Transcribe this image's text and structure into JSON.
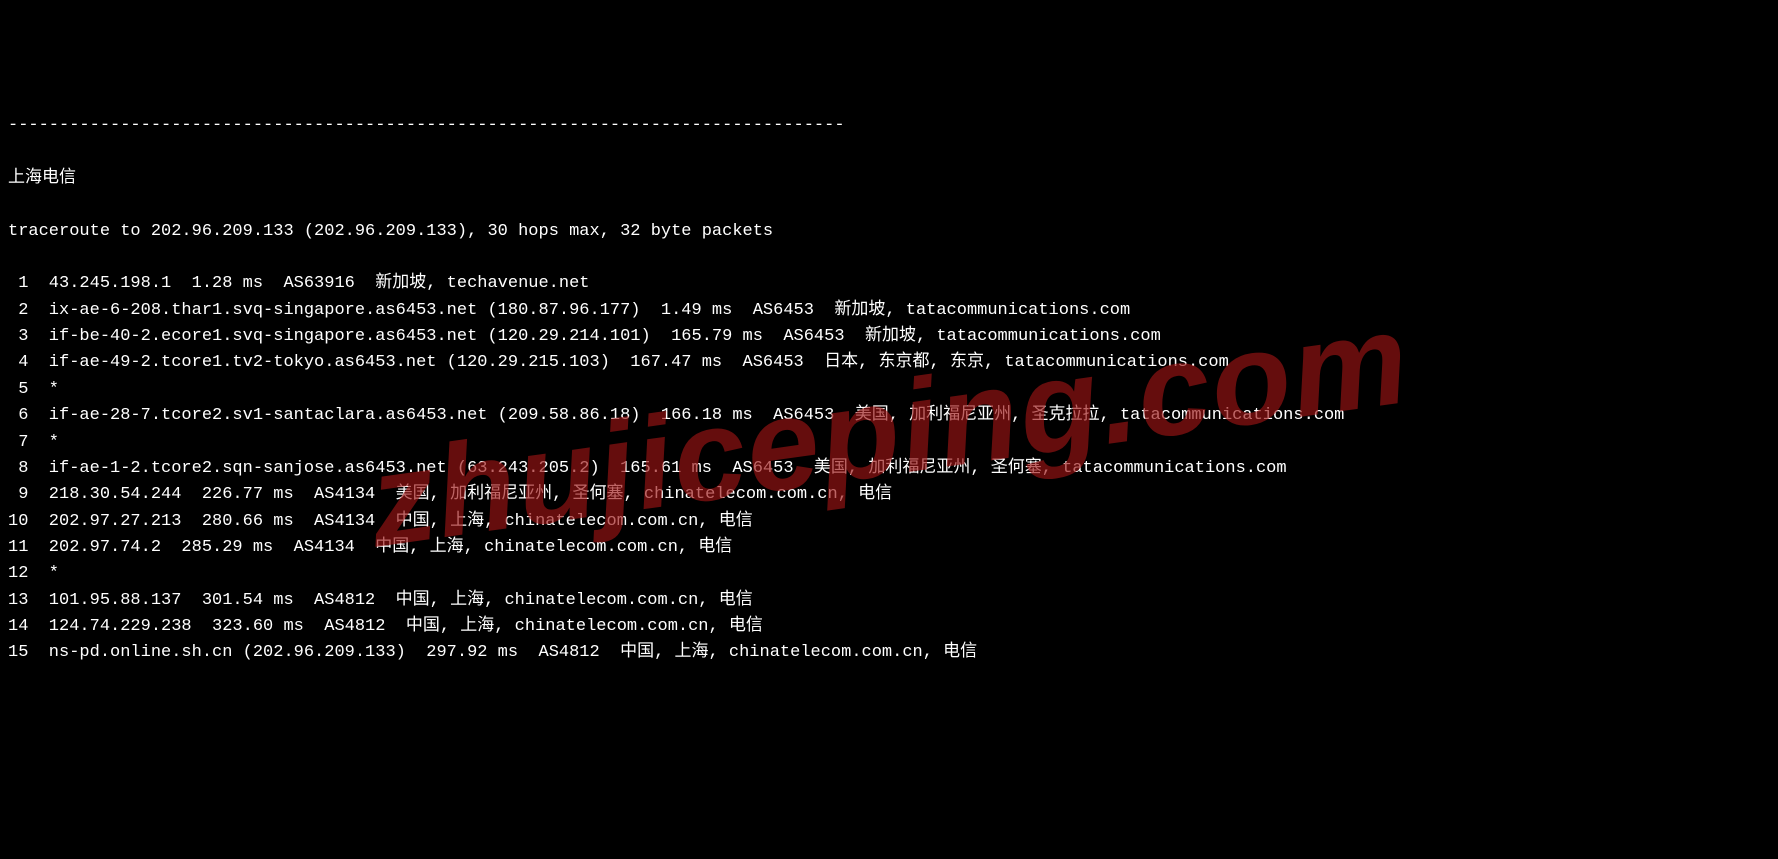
{
  "separator": "----------------------------------------------------------------------------------",
  "title": "上海电信",
  "header": "traceroute to 202.96.209.133 (202.96.209.133), 30 hops max, 32 byte packets",
  "hops": [
    {
      "n": " 1",
      "text": "43.245.198.1  1.28 ms  AS63916  新加坡, techavenue.net"
    },
    {
      "n": " 2",
      "text": "ix-ae-6-208.thar1.svq-singapore.as6453.net (180.87.96.177)  1.49 ms  AS6453  新加坡, tatacommunications.com"
    },
    {
      "n": " 3",
      "text": "if-be-40-2.ecore1.svq-singapore.as6453.net (120.29.214.101)  165.79 ms  AS6453  新加坡, tatacommunications.com"
    },
    {
      "n": " 4",
      "text": "if-ae-49-2.tcore1.tv2-tokyo.as6453.net (120.29.215.103)  167.47 ms  AS6453  日本, 东京都, 东京, tatacommunications.com"
    },
    {
      "n": " 5",
      "text": "*"
    },
    {
      "n": " 6",
      "text": "if-ae-28-7.tcore2.sv1-santaclara.as6453.net (209.58.86.18)  166.18 ms  AS6453  美国, 加利福尼亚州, 圣克拉拉, tatacommunications.com"
    },
    {
      "n": " 7",
      "text": "*"
    },
    {
      "n": " 8",
      "text": "if-ae-1-2.tcore2.sqn-sanjose.as6453.net (63.243.205.2)  165.61 ms  AS6453  美国, 加利福尼亚州, 圣何塞, tatacommunications.com"
    },
    {
      "n": " 9",
      "text": "218.30.54.244  226.77 ms  AS4134  美国, 加利福尼亚州, 圣何塞, chinatelecom.com.cn, 电信"
    },
    {
      "n": "10",
      "text": "202.97.27.213  280.66 ms  AS4134  中国, 上海, chinatelecom.com.cn, 电信"
    },
    {
      "n": "11",
      "text": "202.97.74.2  285.29 ms  AS4134  中国, 上海, chinatelecom.com.cn, 电信"
    },
    {
      "n": "12",
      "text": "*"
    },
    {
      "n": "13",
      "text": "101.95.88.137  301.54 ms  AS4812  中国, 上海, chinatelecom.com.cn, 电信"
    },
    {
      "n": "14",
      "text": "124.74.229.238  323.60 ms  AS4812  中国, 上海, chinatelecom.com.cn, 电信"
    },
    {
      "n": "15",
      "text": "ns-pd.online.sh.cn (202.96.209.133)  297.92 ms  AS4812  中国, 上海, chinatelecom.com.cn, 电信"
    }
  ],
  "watermark": "zhujiceping.com"
}
